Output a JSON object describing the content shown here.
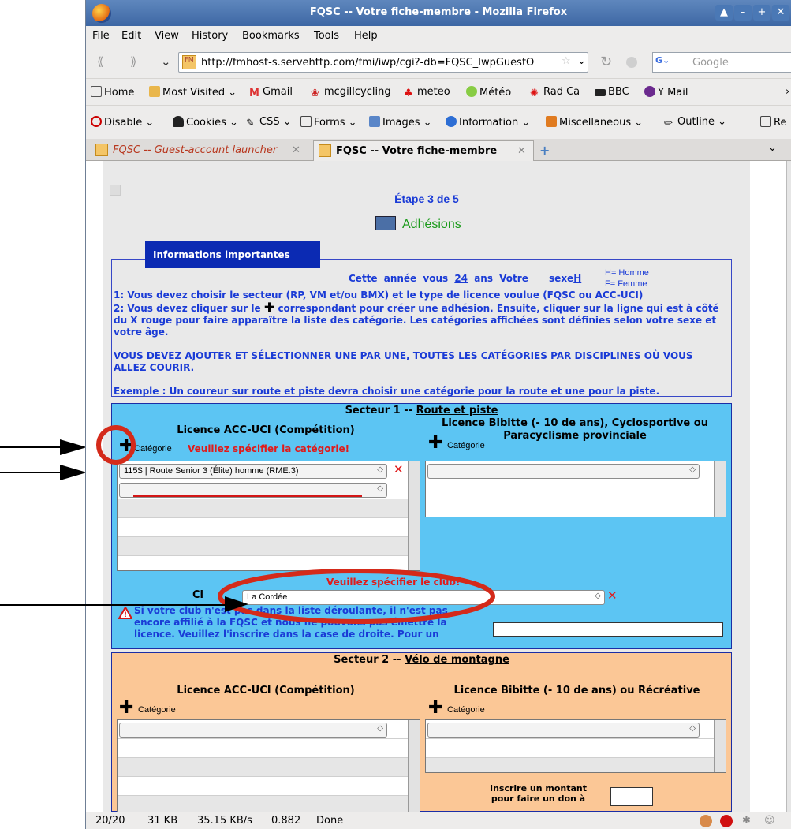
{
  "window": {
    "title": "FQSC -- Votre fiche-membre - Mozilla Firefox"
  },
  "menu": [
    "File",
    "Edit",
    "View",
    "History",
    "Bookmarks",
    "Tools",
    "Help"
  ],
  "nav": {
    "url": "http://fmhost-s.servehttp.com/fmi/iwp/cgi?-db=FQSC_IwpGuestO",
    "search_placeholder": "Google"
  },
  "bookmarks": [
    "Home",
    "Most Visited",
    "Gmail",
    "mcgillcycling",
    "meteo",
    "Météo",
    "Rad Ca",
    "BBC",
    "Y Mail"
  ],
  "webdev": [
    "Disable",
    "Cookies",
    "CSS",
    "Forms",
    "Images",
    "Information",
    "Miscellaneous",
    "Outline",
    "Re"
  ],
  "tabs": [
    {
      "label": "FQSC -- Guest-account launcher"
    },
    {
      "label": "FQSC -- Votre fiche-membre"
    }
  ],
  "page": {
    "step": "Étape 3 de 5",
    "section_title": "Adhésions",
    "info_header": "Informations importantes",
    "age_prefix": "Cette année vous",
    "age": "24",
    "age_suffix": "ans Votre",
    "sex_label": "sexe",
    "sex": "H",
    "legend_h": "H= Homme",
    "legend_f": "F= Femme",
    "instr1": "1: Vous devez choisir le secteur (RP, VM et/ou BMX) et le type de licence voulue (FQSC ou ACC-UCI)",
    "instr2a": "2: Vous devez cliquer sur le",
    "instr2b": "correspondant pour créer une adhésion. Ensuite, cliquer sur la ligne qui est à côté du X rouge pour faire apparaître la liste des catégorie. Les catégories affichées sont définies selon votre sexe et votre âge.",
    "instr3": "VOUS DEVEZ AJOUTER ET SÉLECTIONNER UNE PAR UNE, TOUTES LES CATÉGORIES PAR DISCIPLINES OÙ VOUS ALLEZ COURIR.",
    "instr4": "Exemple : Un coureur sur route et piste devra choisir une catégorie pour la route et une pour la piste.",
    "sector1": {
      "title_prefix": "Secteur 1 --",
      "title": "Route et piste",
      "lic_left": "Licence ACC-UCI (Compétition)",
      "lic_right": "Licence Bibitte (- 10 de ans), Cyclosportive ou Paracyclisme provinciale",
      "cat": "Catégorie",
      "warn_cat": "Veuillez spécifier la catégorie!",
      "selected_cat": "115$ | Route Senior 3 (Élite) homme (RME.3)",
      "warn_club": "Veuillez spécifier le club!",
      "club_label": "Cl",
      "club": "La Cordée",
      "club_msg": "Si votre club n'est pas dans la liste déroulante, il n'est pas encore affilié à la FQSC et nous ne pouvons pas émettre la licence. Veuillez l'inscrire dans la case de droite. Pour un"
    },
    "sector2": {
      "title_prefix": "Secteur 2 --",
      "title": "Vélo de montagne",
      "lic_left": "Licence ACC-UCI (Compétition)",
      "lic_right": "Licence Bibitte (- 10 de ans) ou Récréative",
      "cat": "Catégorie",
      "donation": "Inscrire un montant pour faire un don à"
    }
  },
  "status": {
    "count": "20/20",
    "size": "31 KB",
    "speed": "35.15 KB/s",
    "time": "0.882",
    "state": "Done"
  }
}
